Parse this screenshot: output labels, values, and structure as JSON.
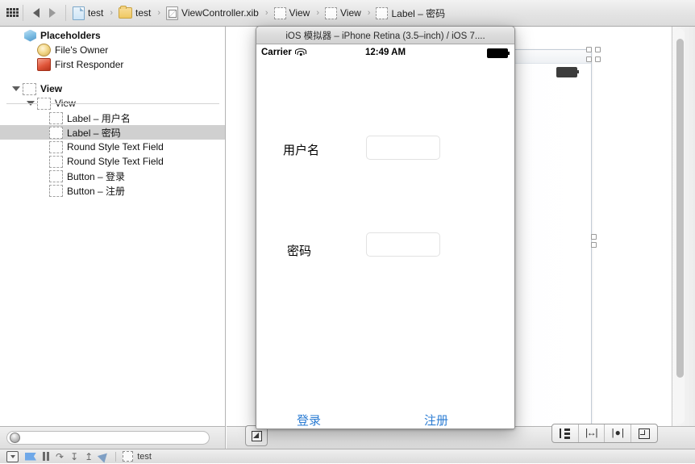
{
  "jumpbar": {
    "grid_icon": "grid-icon",
    "back_icon": "back-arrow-icon",
    "forward_icon": "forward-arrow-icon",
    "breadcrumbs": [
      {
        "label": "test",
        "icon": "project-document-icon"
      },
      {
        "label": "test",
        "icon": "folder-icon"
      },
      {
        "label": "ViewController.xib",
        "icon": "xib-file-icon"
      },
      {
        "label": "View",
        "icon": "view-icon"
      },
      {
        "label": "View",
        "icon": "view-icon"
      },
      {
        "label": "Label – 密码",
        "icon": "view-icon"
      }
    ],
    "separator": "›"
  },
  "navigator": {
    "placeholders": {
      "title": "Placeholders",
      "icon": "cube-icon",
      "items": [
        {
          "label": "File's Owner",
          "icon": "file-owner-icon"
        },
        {
          "label": "First Responder",
          "icon": "first-responder-icon"
        }
      ]
    },
    "objects": [
      {
        "label": "View",
        "icon": "view-box-icon",
        "indent": 0,
        "expanded": true,
        "selected": false
      },
      {
        "label": "View",
        "icon": "view-box-icon",
        "indent": 1,
        "expanded": true,
        "selected": false
      },
      {
        "label": "Label – 用户名",
        "icon": "view-box-icon",
        "indent": 2,
        "expanded": false,
        "selected": false
      },
      {
        "label": "Label – 密码",
        "icon": "view-box-icon",
        "indent": 2,
        "expanded": false,
        "selected": true
      },
      {
        "label": "Round Style Text Field",
        "icon": "view-box-icon",
        "indent": 2,
        "expanded": false,
        "selected": false
      },
      {
        "label": "Round Style Text Field",
        "icon": "view-box-icon",
        "indent": 2,
        "expanded": false,
        "selected": false
      },
      {
        "label": "Button – 登录",
        "icon": "view-box-icon",
        "indent": 2,
        "expanded": false,
        "selected": false
      },
      {
        "label": "Button – 注册",
        "icon": "view-box-icon",
        "indent": 2,
        "expanded": false,
        "selected": false
      }
    ],
    "filter": {
      "value": "",
      "placeholder": "",
      "icon": "filter-knob-icon"
    }
  },
  "simulator": {
    "window_title": "iOS 模拟器 – iPhone Retina (3.5–inch) / iOS 7....",
    "statusbar": {
      "carrier": "Carrier",
      "wifi_icon": "wifi-icon",
      "time": "12:49 AM",
      "battery_icon": "battery-full-icon"
    },
    "form": {
      "username_label": "用户名",
      "password_label": "密码",
      "username_value": "",
      "password_value": "",
      "login_button": "登录",
      "register_button": "注册"
    },
    "accent_color": "#2b7cd3"
  },
  "canvas": {
    "zoom_out_button_icon": "zoom-out-icon",
    "layout_buttons": [
      {
        "name": "align-button",
        "icon": "align-icon"
      },
      {
        "name": "pin-button",
        "icon": "pin-icon"
      },
      {
        "name": "resolve-issues-button",
        "icon": "resolve-icon"
      },
      {
        "name": "resizing-behavior-button",
        "icon": "resize-icon"
      }
    ],
    "device_battery_icon": "battery-icon"
  },
  "debugbar": {
    "hide_debug_icon": "hide-debug-area-icon",
    "breakpoints_icon": "breakpoint-flag-icon",
    "pause_icon": "pause-icon",
    "step_over_icon": "step-over-icon",
    "step_into_icon": "step-into-icon",
    "step_out_icon": "step-out-icon",
    "location_icon": "simulate-location-icon",
    "stack_icon": "stack-frame-icon",
    "process_label": "test"
  }
}
